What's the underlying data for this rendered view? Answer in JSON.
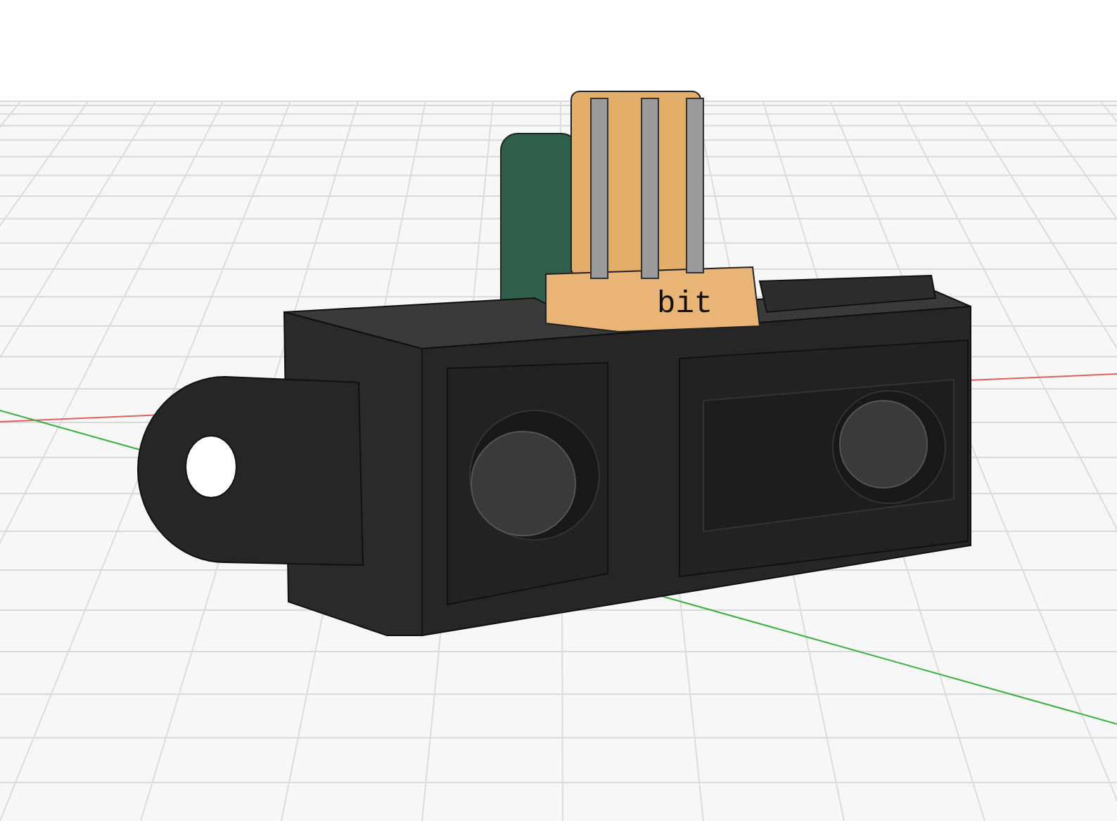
{
  "viewport": {
    "model": {
      "connector_label": "bit"
    }
  }
}
